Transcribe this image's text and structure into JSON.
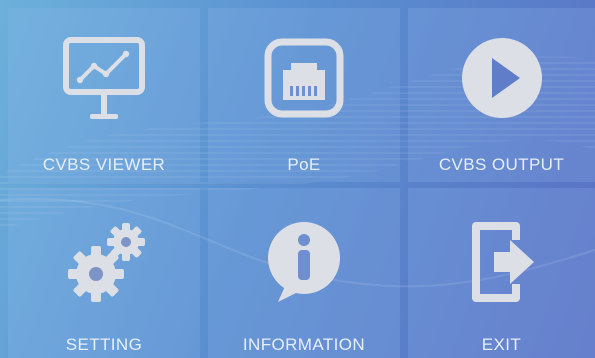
{
  "menu": {
    "items": [
      {
        "label": "CVBS VIEWER",
        "icon": "monitor-chart-icon"
      },
      {
        "label": "PoE",
        "icon": "ethernet-port-icon"
      },
      {
        "label": "CVBS OUTPUT",
        "icon": "play-circle-icon"
      },
      {
        "label": "SETTING",
        "icon": "gears-icon"
      },
      {
        "label": "INFORMATION",
        "icon": "info-bubble-icon"
      },
      {
        "label": "EXIT",
        "icon": "exit-arrow-icon"
      }
    ]
  },
  "colors": {
    "background_start": "#6cb0db",
    "background_end": "#5a6fc4",
    "icon": "#dcdfe6",
    "label": "#e6eef8",
    "divider": "#3d6db0"
  }
}
